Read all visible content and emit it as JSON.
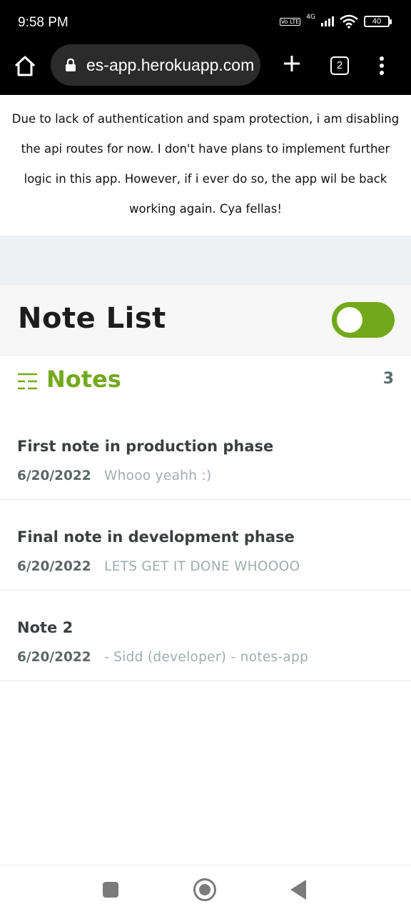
{
  "status_bar": {
    "time": "9:58 PM",
    "volte_label": "Vo LTE",
    "network_label": "4G",
    "battery_level": "40"
  },
  "browser": {
    "url": "es-app.herokuapp.com",
    "tab_count": "2"
  },
  "notice": {
    "text": "Due to lack of authentication and spam protection, i am disabling the api routes for now. I don't have plans to implement further logic in this app. However, if i ever do so, the app wil be back working again. Cya fellas!"
  },
  "header": {
    "title": "Note List",
    "toggle_on": true
  },
  "notes_section": {
    "title": "Notes",
    "count": "3"
  },
  "notes": [
    {
      "title": "First note in production phase",
      "date": "6/20/2022",
      "description": "Whooo yeahh :)"
    },
    {
      "title": "Final note in development phase",
      "date": "6/20/2022",
      "description": "LETS GET IT DONE WHOOOO"
    },
    {
      "title": "Note 2",
      "date": "6/20/2022",
      "description": "- Sidd (developer) - notes-app"
    }
  ],
  "colors": {
    "accent_green": "#72a81a",
    "title_dark": "#1d1d1d",
    "muted_text": "#a3acb2"
  }
}
